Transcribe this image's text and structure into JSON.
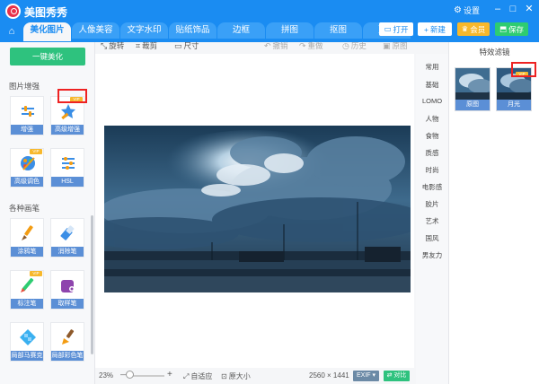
{
  "app": {
    "title": "美图秀秀"
  },
  "header_right": {
    "settings": "设置"
  },
  "nav": {
    "tabs": [
      "美化图片",
      "人像美容",
      "文字水印",
      "贴纸饰品",
      "边框",
      "拼图",
      "抠图",
      "更多"
    ]
  },
  "toolbar": {
    "open": "打开",
    "new": "新建",
    "vip": "会员",
    "save": "保存"
  },
  "left": {
    "beautify_button": "一键美化",
    "section_enhance": "图片增强",
    "section_brushes": "各种画笔",
    "tools": [
      {
        "label": "增强",
        "icon": "sliders-icon",
        "vip": false
      },
      {
        "label": "高级增强",
        "icon": "magic-star-icon",
        "vip": true
      },
      {
        "label": "高级调色",
        "icon": "palette-icon",
        "vip": true
      },
      {
        "label": "HSL",
        "icon": "hsl-sliders-icon",
        "vip": false
      },
      {
        "label": "涂鸦笔",
        "icon": "brush-icon",
        "vip": false
      },
      {
        "label": "消除笔",
        "icon": "eraser-icon",
        "vip": false
      },
      {
        "label": "标注笔",
        "icon": "pencil-icon",
        "vip": true
      },
      {
        "label": "取样笔",
        "icon": "sample-pen-icon",
        "vip": false
      },
      {
        "label": "局部马赛克",
        "icon": "mosaic-icon",
        "vip": false
      },
      {
        "label": "局部彩色笔",
        "icon": "color-brush-icon",
        "vip": false
      }
    ],
    "vip_text": "VIP"
  },
  "edit_toolbar": {
    "rotate": "旋转",
    "crop": "裁剪",
    "size": "尺寸",
    "undo": "撤销",
    "redo": "重做",
    "history": "历史",
    "original": "原图"
  },
  "bottom": {
    "zoom": "23%",
    "zoom_minus": "—",
    "zoom_plus": "+",
    "fit": "自适应",
    "actual_size": "原大小",
    "dimensions": "2560 × 1441",
    "exif": "EXIF ▾",
    "compare": "对比"
  },
  "right": {
    "title": "特效滤镜",
    "categories": [
      "常用",
      "基础",
      "LOMO",
      "人物",
      "食物",
      "质感",
      "时尚",
      "电影感",
      "胶片",
      "艺术",
      "国风",
      "男友力"
    ],
    "filters": [
      {
        "label": "原图",
        "vip": false
      },
      {
        "label": "月光",
        "vip": true
      }
    ]
  },
  "colors": {
    "brand_blue": "#1a8cf2",
    "green": "#2ec27e",
    "vip_gold": "#f7b82c",
    "highlight_red": "#e22222"
  }
}
